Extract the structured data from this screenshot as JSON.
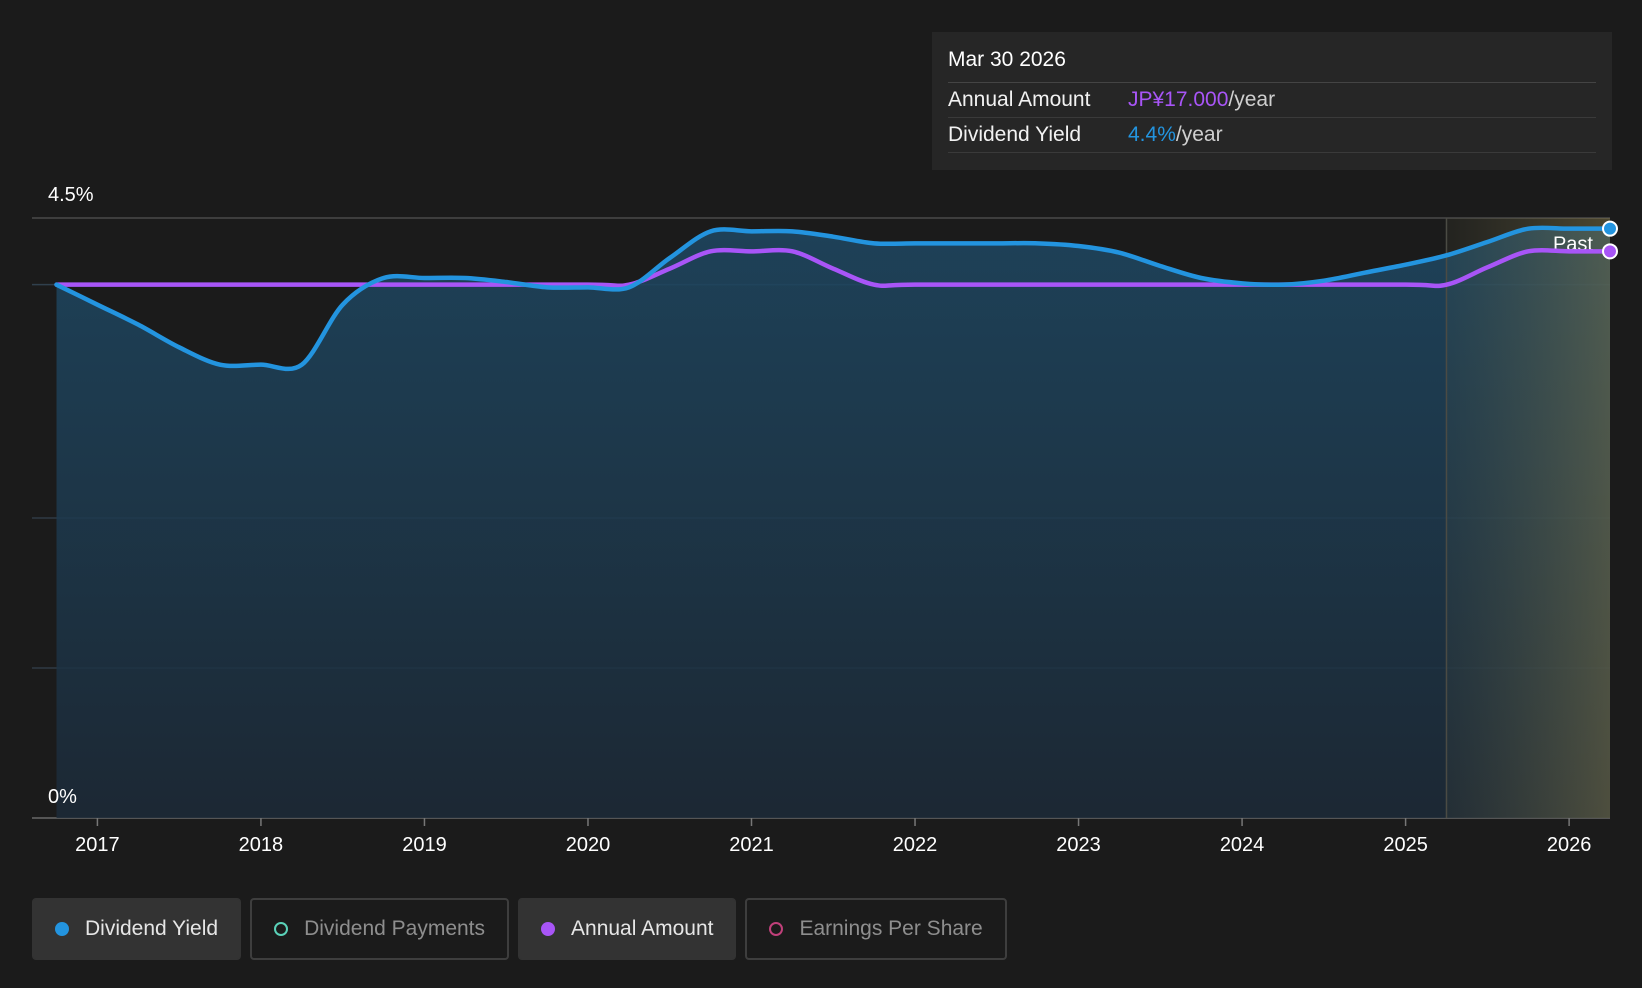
{
  "tooltip": {
    "date": "Mar 30 2026",
    "rows": [
      {
        "label": "Annual Amount",
        "value": "JP¥17.000",
        "unit": "/year",
        "color": "#a855f7"
      },
      {
        "label": "Dividend Yield",
        "value": "4.4%",
        "unit": "/year",
        "color": "#2394df"
      }
    ]
  },
  "chart_data": {
    "type": "line",
    "y_tick_labels": [
      "4.5%",
      "0%"
    ],
    "x_tick_labels": [
      "2017",
      "2018",
      "2019",
      "2020",
      "2021",
      "2022",
      "2023",
      "2024",
      "2025",
      "2026"
    ],
    "xlim": [
      2016.6,
      2026.25
    ],
    "ylim": [
      0,
      4.5
    ],
    "past_label": "Past",
    "past_region_start": 2025.25,
    "grid": true,
    "series": [
      {
        "name": "Dividend Yield",
        "color": "#2394df",
        "filled": true,
        "x": [
          2016.75,
          2017.0,
          2017.25,
          2017.5,
          2017.75,
          2018.0,
          2018.25,
          2018.5,
          2018.75,
          2019.0,
          2019.25,
          2019.5,
          2019.75,
          2020.0,
          2020.25,
          2020.5,
          2020.75,
          2021.0,
          2021.25,
          2021.5,
          2021.75,
          2022.0,
          2022.25,
          2022.5,
          2022.75,
          2023.0,
          2023.25,
          2023.5,
          2023.75,
          2024.0,
          2024.25,
          2024.5,
          2024.75,
          2025.0,
          2025.25,
          2025.5,
          2025.75,
          2026.0,
          2026.25
        ],
        "values": [
          4.0,
          3.85,
          3.7,
          3.53,
          3.4,
          3.4,
          3.4,
          3.85,
          4.05,
          4.05,
          4.05,
          4.02,
          3.98,
          3.98,
          3.98,
          4.2,
          4.4,
          4.4,
          4.4,
          4.36,
          4.31,
          4.31,
          4.31,
          4.31,
          4.31,
          4.29,
          4.24,
          4.14,
          4.05,
          4.01,
          4.0,
          4.03,
          4.09,
          4.15,
          4.22,
          4.32,
          4.42,
          4.42,
          4.42
        ]
      },
      {
        "name": "Annual Amount",
        "color": "#a855f7",
        "filled": false,
        "x": [
          2016.75,
          2017.0,
          2018.0,
          2019.0,
          2020.0,
          2020.25,
          2020.5,
          2020.75,
          2021.0,
          2021.25,
          2021.5,
          2021.75,
          2022.0,
          2023.0,
          2024.0,
          2025.0,
          2025.25,
          2025.5,
          2025.75,
          2026.0,
          2026.25
        ],
        "values": [
          4.0,
          4.0,
          4.0,
          4.0,
          4.0,
          4.0,
          4.12,
          4.25,
          4.25,
          4.25,
          4.12,
          4.0,
          4.0,
          4.0,
          4.0,
          4.0,
          4.0,
          4.13,
          4.25,
          4.25,
          4.25
        ]
      }
    ]
  },
  "legend": [
    {
      "label": "Dividend Yield",
      "active": true,
      "color": "#2394df",
      "filled_dot": true
    },
    {
      "label": "Dividend Payments",
      "active": false,
      "color": "#5ad1b8",
      "filled_dot": false
    },
    {
      "label": "Annual Amount",
      "active": true,
      "color": "#a855f7",
      "filled_dot": true
    },
    {
      "label": "Earnings Per Share",
      "active": false,
      "color": "#c0407a",
      "filled_dot": false
    }
  ]
}
